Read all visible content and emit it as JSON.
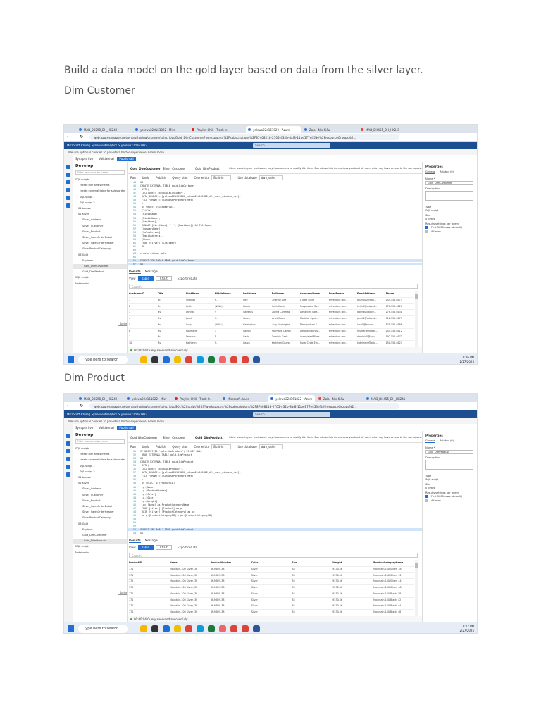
{
  "document": {
    "intro": "Build a data model on the gold layer based on data from the silver layer.",
    "heading_customer": "Dim Customer",
    "heading_product": "Dim Product"
  },
  "screens": [
    {
      "browser_tabs": [
        "MAD_20298_DH_HK242 -",
        "yelewa22d161822 - Micr",
        "Playlist Chill - Track In",
        "yelewa22d161822 - Azure",
        "Zalo - Nie Kiều",
        "MAD_DH455_DH_HK241"
      ],
      "url": "web.azuresynapse.net/en/authoring/analyze/sqlscripts/Gold_DimCustomer?workspace=%2Fsubscriptions%2F87408218-2705-432b-8af8-11be177e453e%2FresourceGroups%2...",
      "azure_title": "Microsoft Azure  |  Synapse Analytics  >  yelewa22d161822",
      "azure_search": "Search",
      "cookie_text": "We use optional cookies to provide a better experience. Learn more",
      "toolbar": {
        "workspace": "Synapse live",
        "validate": "Validate all",
        "publish": "Publish all"
      },
      "sidebar_title": "Develop",
      "sidebar_filter": "Filter resources by name",
      "sidebar_items": [
        "SQL scripts",
        "create dim and schema",
        "create external table for sales order",
        "SQL script 1",
        "SQL script 2",
        "01 bronze",
        "02 silver",
        "Silver_Address",
        "Silver_Customer",
        "Silver_Product",
        "Silver_SalesOrderDetail",
        "Silver_SalesOrderHeader",
        "SilverProductCategory",
        "03 Gold",
        "Explorer",
        "Gold_DimCustomer",
        "Gold_DimProduct",
        "KQL scripts",
        "Notebooks"
      ],
      "selected_item": 15,
      "actions_tooltip": "Actions",
      "editor_tabs": [
        "Gold_DimCustomer",
        "Silver_Customer",
        "Gold_DimProduct"
      ],
      "notice": "Other users in your workspace may have access to modify this item. Do not use this item unless you trust all users who may have access to the workspace.",
      "editor_toolbar": {
        "run": "Run",
        "undo": "Undo",
        "publish": "Publish",
        "query_plan": "Query plan",
        "connect_to": "Connect to",
        "connection": "Built-in",
        "use_db": "Use database",
        "db": "dwh_sales"
      },
      "code_start": 44,
      "code": [
        "GO",
        "CREATE EXTERNAL TABLE gold.DimCustomer",
        "    WITH(",
        "        LOCATION = 'gold/DimCustomer',",
        "        DATA_SOURCE = [yelewa22d161822_yelewa22d161822_dfs_core_windows_net],",
        "        FILE_FORMAT = [SynapseParquetFormat]",
        "    )",
        "    AS select [CustomerID],",
        "    [Title],",
        "    [FirstName],",
        "    [MiddleName],",
        "    [LastName],",
        "    CONCAT([FirstName], ' ', [LastName]) AS FullName,",
        "    [CompanyName],",
        "    [SalesPerson],",
        "    [EmailAddress],",
        "    [Phone]",
        "    FROM [silver].[Customer]",
        "    GO",
        "",
        "create schema gold",
        "",
        "SELECT TOP 100 * FROM gold.DimCustomer",
        "GO"
      ],
      "highlight_lines": [
        22,
        23
      ],
      "results_tabs": [
        "Results",
        "Messages"
      ],
      "view_label": "View",
      "view_buttons": [
        "Table",
        "Chart"
      ],
      "export": "Export results",
      "search": "Search",
      "columns": [
        "CustomerID",
        "Title",
        "FirstName",
        "MiddleName",
        "LastName",
        "FullName",
        "CompanyName",
        "SalesPerson",
        "EmailAddress",
        "Phone"
      ],
      "rows": [
        [
          "1",
          "Mr.",
          "Orlando",
          "N.",
          "Gee",
          "Orlando Gee",
          "A Bike Store",
          "adventure-wor...",
          "orlando0@adv...",
          "245-555-0173"
        ],
        [
          "2",
          "Mr.",
          "Keith",
          "(NULL)",
          "Harris",
          "Keith Harris",
          "Progressive Sp...",
          "adventure-wor...",
          "keith0@advent...",
          "170-555-0127"
        ],
        [
          "3",
          "Ms.",
          "Donna",
          "F.",
          "Carreras",
          "Donna Carreras",
          "Advanced Bike...",
          "adventure-wor...",
          "donna0@adve...",
          "279-555-0130"
        ],
        [
          "4",
          "Ms.",
          "Janet",
          "M.",
          "Gates",
          "Janet Gates",
          "Modular Cycle...",
          "adventure-wor...",
          "janet1@advent...",
          "710-555-0173"
        ],
        [
          "5",
          "Ms.",
          "Lucy",
          "(NULL)",
          "Harrington",
          "Lucy Harrington",
          "Metropolitan S...",
          "adventure-wor...",
          "lucy0@advent...",
          "828-555-0186"
        ],
        [
          "6",
          "Ms.",
          "Rosmarie",
          "J.",
          "Carroll",
          "Rosmarie Carroll",
          "Aerobic Exercis...",
          "adventure-wor...",
          "rosmarie0@adv...",
          "244-555-0112"
        ],
        [
          "7",
          "Mr.",
          "Dominic",
          "P.",
          "Gash",
          "Dominic Gash",
          "Associated Bikes",
          "adventure-wor...",
          "dominic0@adv...",
          "192-555-0173"
        ],
        [
          "10",
          "Ms.",
          "Kathleen",
          "M.",
          "Garza",
          "Kathleen Garza",
          "Rural Cycle Em...",
          "adventure-wor...",
          "kathleen0@adv...",
          "150-555-0127"
        ]
      ],
      "status": "00:00:04 Query executed successfully",
      "properties": {
        "title": "Properties",
        "tabs": [
          "General",
          "Related (0)"
        ],
        "name_label": "Name *",
        "name_value": "Gold_DimCustomer",
        "desc_label": "Description",
        "type_label": "Type",
        "type_value": "SQL script",
        "size_label": "Size",
        "size_value": "0 bytes",
        "results_label": "Results settings per query",
        "opt1": "First 5000 rows (default)",
        "opt2": "All rows"
      },
      "taskbar": {
        "search": "Type here to search",
        "time": "8:26 PM",
        "date": "2/27/2025"
      }
    },
    {
      "browser_tabs": [
        "MAD_20298_DH_HK242 -",
        "yelewa22d161822 - Micr",
        "Playlist Chill - Track In",
        "Microsoft Azure",
        "yelewa22d161822 - Azure",
        "Zalo - Nie Kiều",
        "MAD_DH455_DH_HK241"
      ],
      "url": "web.azuresynapse.net/en/authoring/analyze/sqlscripts/SQL%20script%203?workspace=%2Fsubscriptions%2F87408218-2705-432b-8af8-11be177e453e%2FresourceGroups%2...",
      "azure_title": "Microsoft Azure  |  Synapse Analytics  >  yelewa22d161822",
      "azure_search": "Search",
      "cookie_text": "We use optional cookies to provide a better experience. Learn more",
      "toolbar": {
        "workspace": "Synapse live",
        "validate": "Validate all",
        "publish": "Publish all"
      },
      "sidebar_title": "Develop",
      "sidebar_filter": "Filter resources by name",
      "sidebar_items": [
        "SQL scripts",
        "create dim and schema",
        "create external table for sales order",
        "SQL script 1",
        "SQL script 2",
        "01 bronze",
        "02 silver",
        "Silver_Address",
        "Silver_Customer",
        "Silver_Product",
        "Silver_SalesOrderDetail",
        "Silver_SalesOrderHeader",
        "SilverProductCategory",
        "03 Gold",
        "Explorer",
        "Gold_DimCustomer",
        "Gold_DimProduct",
        "KQL scripts",
        "Notebooks"
      ],
      "selected_item": 16,
      "actions_tooltip": "Actions",
      "editor_tabs": [
        "Gold_DimCustomer",
        "Silver_Customer",
        "Gold_DimProduct"
      ],
      "notice": "Other users in your workspace may have access to modify this item. Do not use this item unless you trust all users who may have access to the workspace.",
      "editor_toolbar": {
        "run": "Run",
        "undo": "Undo",
        "publish": "Publish",
        "query_plan": "Query plan",
        "connect_to": "Connect to",
        "connection": "Built-in",
        "use_db": "Use database",
        "db": "dwh_sales"
      },
      "code_start": 31,
      "code": [
        "IF OBJECT_ID('gold.DimProduct') IS NOT NULL",
        "    DROP EXTERNAL TABLE gold.DimProduct",
        "GO",
        "CREATE EXTERNAL TABLE gold.DimProduct",
        "    WITH(",
        "        LOCATION = 'gold/DimProduct',",
        "        DATA_SOURCE = [yelewa22d161822_yelewa22d161822_dfs_core_windows_net],",
        "        FILE_FORMAT = [SynapseParquetFormat]",
        "    )",
        "    AS SELECT p.[ProductID]",
        "        ,p.[Name]",
        "        ,p.[ProductNumber]",
        "        ,p.[Color]",
        "        ,p.[Size]",
        "        ,p.[Weight]",
        "        ,pc.[Name] as ProductCategoryName",
        "    FROM [silver].[Product] as p",
        "    JOIN [silver].[ProductCategory] as pc",
        "    on p.[ProductCategoryID] = pc.[ProductCategoryID]",
        "",
        "",
        "",
        "SELECT TOP 100 * FROM gold.DimProduct",
        "GO"
      ],
      "highlight_lines": [
        22
      ],
      "results_tabs": [
        "Results",
        "Messages"
      ],
      "view_label": "View",
      "view_buttons": [
        "Table",
        "Chart"
      ],
      "export": "Export results",
      "search": "Search",
      "columns": [
        "ProductID",
        "Name",
        "ProductNumber",
        "Color",
        "Size",
        "Weight",
        "ProductCategoryName"
      ],
      "rows": [
        [
          "771",
          "Mountain-100 Silver, 38",
          "BK-M82S-38",
          "Silver",
          "38",
          "9230.56",
          "Mountain-100 Silver, 38"
        ],
        [
          "771",
          "Mountain-100 Silver, 38",
          "BK-M82S-38",
          "Silver",
          "38",
          "9230.56",
          "Mountain-100 Silver, 42"
        ],
        [
          "771",
          "Mountain-100 Silver, 38",
          "BK-M82S-38",
          "Silver",
          "38",
          "9230.56",
          "Mountain-100 Silver, 44"
        ],
        [
          "771",
          "Mountain-100 Silver, 38",
          "BK-M82S-38",
          "Silver",
          "38",
          "9230.56",
          "Mountain-100 Silver, 48"
        ],
        [
          "771",
          "Mountain-100 Silver, 38",
          "BK-M82S-38",
          "Silver",
          "38",
          "9230.56",
          "Mountain-100 Black, 38"
        ],
        [
          "771",
          "Mountain-100 Silver, 38",
          "BK-M82S-38",
          "Silver",
          "38",
          "9230.56",
          "Mountain-100 Black, 42"
        ],
        [
          "771",
          "Mountain-100 Silver, 38",
          "BK-M82S-38",
          "Silver",
          "38",
          "9230.56",
          "Mountain-100 Black, 44"
        ],
        [
          "771",
          "Mountain-100 Silver, 38",
          "BK-M82S-38",
          "Silver",
          "38",
          "9230.56",
          "Mountain-100 Black, 48"
        ]
      ],
      "status": "00:00:04 Query executed successfully",
      "properties": {
        "title": "Properties",
        "tabs": [
          "General",
          "Related (0)"
        ],
        "name_label": "Name *",
        "name_value": "Gold_DimProduct",
        "desc_label": "Description",
        "type_label": "Type",
        "type_value": "SQL script",
        "size_label": "Size",
        "size_value": "0 bytes",
        "results_label": "Results settings per query",
        "opt1": "First 5000 rows (default)",
        "opt2": "All rows"
      },
      "taskbar": {
        "search": "Type here to search",
        "time": "8:27 PM",
        "date": "2/27/2025"
      }
    }
  ],
  "colors": {
    "azure_header": "#1b4f91",
    "accent": "#1f6fd1",
    "tab_bar": "#dde3ec",
    "taskbar": "#e6edf6"
  }
}
